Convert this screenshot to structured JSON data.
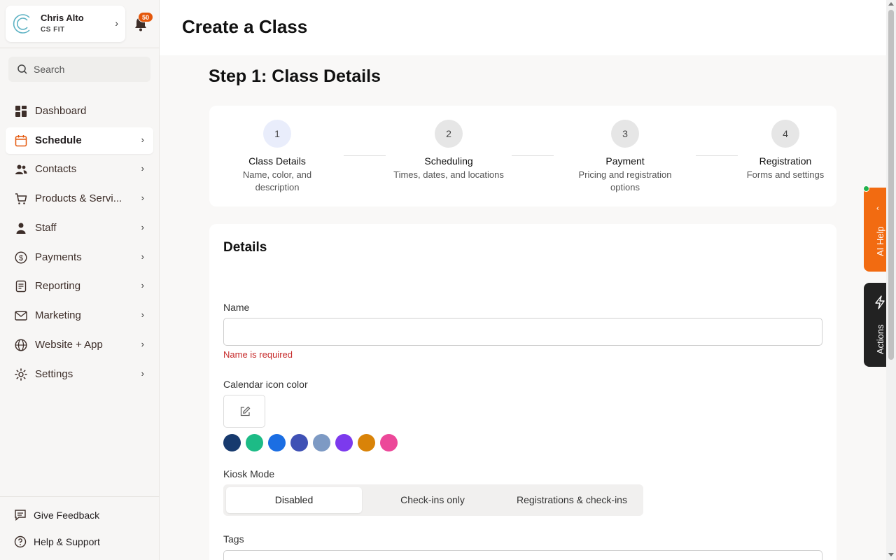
{
  "account": {
    "name": "Chris Alto",
    "org": "CS FIT"
  },
  "notifications": {
    "count": "50"
  },
  "search": {
    "placeholder": "Search"
  },
  "nav": [
    {
      "label": "Dashboard",
      "icon": "dashboard-icon",
      "active": false,
      "has_chevron": false
    },
    {
      "label": "Schedule",
      "icon": "calendar-icon",
      "active": true,
      "has_chevron": true
    },
    {
      "label": "Contacts",
      "icon": "contacts-icon",
      "active": false,
      "has_chevron": true
    },
    {
      "label": "Products & Servi...",
      "icon": "cart-icon",
      "active": false,
      "has_chevron": true
    },
    {
      "label": "Staff",
      "icon": "staff-icon",
      "active": false,
      "has_chevron": true
    },
    {
      "label": "Payments",
      "icon": "dollar-icon",
      "active": false,
      "has_chevron": true
    },
    {
      "label": "Reporting",
      "icon": "report-icon",
      "active": false,
      "has_chevron": true
    },
    {
      "label": "Marketing",
      "icon": "mail-icon",
      "active": false,
      "has_chevron": true
    },
    {
      "label": "Website + App",
      "icon": "globe-icon",
      "active": false,
      "has_chevron": true
    },
    {
      "label": "Settings",
      "icon": "gear-icon",
      "active": false,
      "has_chevron": true
    }
  ],
  "footer": {
    "feedback": "Give Feedback",
    "help": "Help & Support"
  },
  "page": {
    "title": "Create a Class",
    "step_title": "Step 1: Class Details"
  },
  "steps": [
    {
      "number": "1",
      "title": "Class Details",
      "desc": "Name, color, and description",
      "current": true
    },
    {
      "number": "2",
      "title": "Scheduling",
      "desc": "Times, dates, and locations",
      "current": false
    },
    {
      "number": "3",
      "title": "Payment",
      "desc": "Pricing and registration options",
      "current": false
    },
    {
      "number": "4",
      "title": "Registration",
      "desc": "Forms and settings",
      "current": false
    }
  ],
  "details": {
    "title": "Details",
    "name_label": "Name",
    "name_value": "",
    "name_error": "Name is required",
    "color_label": "Calendar icon color",
    "swatches": [
      "#173a6e",
      "#1dbb86",
      "#1b6ee3",
      "#3f51b5",
      "#7d9ac4",
      "#7c3aed",
      "#d98308",
      "#ec4899"
    ],
    "kiosk_label": "Kiosk Mode",
    "kiosk_options": [
      "Disabled",
      "Check-ins only",
      "Registrations & check-ins"
    ],
    "kiosk_selected": "Disabled",
    "tags_label": "Tags"
  },
  "side_tabs": {
    "ai_help": "AI Help",
    "actions": "Actions"
  },
  "colors": {
    "accent": "#f26b11",
    "error": "#c62a2a",
    "badge": "#e4570b"
  }
}
